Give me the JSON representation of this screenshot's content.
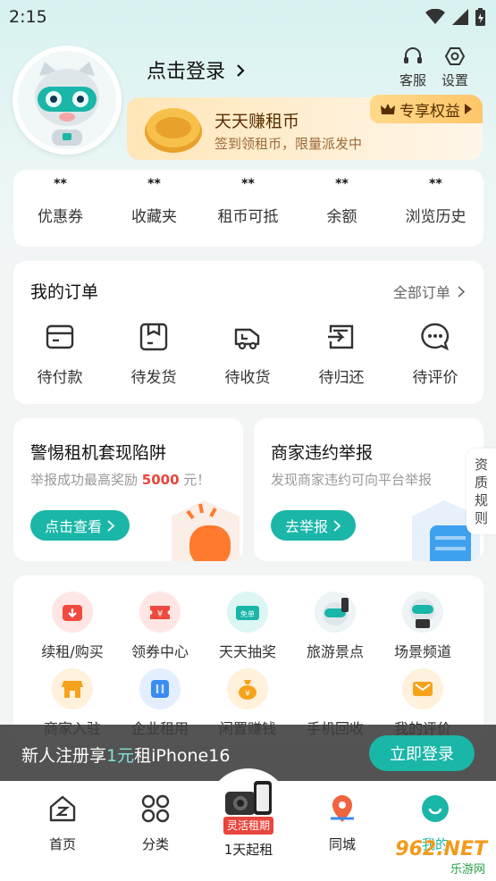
{
  "status": {
    "time": "2:15"
  },
  "header": {
    "login_label": "点击登录",
    "service_label": "客服",
    "settings_label": "设置"
  },
  "coin_banner": {
    "title": "天天赚租币",
    "subtitle": "签到领租币，限量派发中",
    "vip_label": "专享权益"
  },
  "stats": [
    {
      "value": "**",
      "label": "优惠券"
    },
    {
      "value": "**",
      "label": "收藏夹"
    },
    {
      "value": "**",
      "label": "租币可抵"
    },
    {
      "value": "**",
      "label": "余额"
    },
    {
      "value": "**",
      "label": "浏览历史"
    }
  ],
  "orders": {
    "title": "我的订单",
    "all_label": "全部订单",
    "items": [
      {
        "label": "待付款",
        "icon": "wallet-icon"
      },
      {
        "label": "待发货",
        "icon": "package-icon"
      },
      {
        "label": "待收货",
        "icon": "truck-icon"
      },
      {
        "label": "待归还",
        "icon": "return-icon"
      },
      {
        "label": "待评价",
        "icon": "comment-icon"
      }
    ]
  },
  "promos": [
    {
      "title": "警惕租机套现陷阱",
      "sub_prefix": "举报成功最高奖励 ",
      "sub_highlight": "5000",
      "sub_suffix": " 元！",
      "button": "点击查看"
    },
    {
      "title": "商家违约举报",
      "subtitle": "发现商家违约可向平台举报",
      "button": "去举报"
    }
  ],
  "side_tab": {
    "chars": [
      "资",
      "质",
      "规",
      "则"
    ]
  },
  "services": [
    {
      "label": "续租/购买",
      "icon": "renew-icon"
    },
    {
      "label": "领券中心",
      "icon": "coupon-icon"
    },
    {
      "label": "天天抽奖",
      "icon": "lottery-icon",
      "tag": "免单"
    },
    {
      "label": "旅游景点",
      "icon": "travel-icon"
    },
    {
      "label": "场景频道",
      "icon": "scene-icon"
    },
    {
      "label": "商家入驻",
      "icon": "store-icon"
    },
    {
      "label": "企业租用",
      "icon": "enterprise-icon"
    },
    {
      "label": "闲置赚钱",
      "icon": "money-bag-icon"
    },
    {
      "label": "手机回收",
      "icon": "phone-recycle-icon"
    },
    {
      "label": "我的评价",
      "icon": "review-icon"
    }
  ],
  "register_bar": {
    "text_prefix": "新人注册享",
    "text_highlight": "1元",
    "text_suffix": "租iPhone16",
    "button": "立即登录"
  },
  "tabbar": {
    "items": [
      {
        "label": "首页",
        "icon": "home-icon"
      },
      {
        "label": "分类",
        "icon": "category-icon"
      },
      {
        "label": "1天起租",
        "icon": "camera-phone-icon",
        "badge": "灵活租期"
      },
      {
        "label": "同城",
        "icon": "map-pin-icon"
      },
      {
        "label": "我的",
        "icon": "profile-icon"
      }
    ]
  },
  "watermark": {
    "text": "962.NET",
    "sub": "乐游网"
  },
  "colors": {
    "accent": "#1ab6a8",
    "gold": "#ffc66a",
    "red": "#e8463c"
  }
}
